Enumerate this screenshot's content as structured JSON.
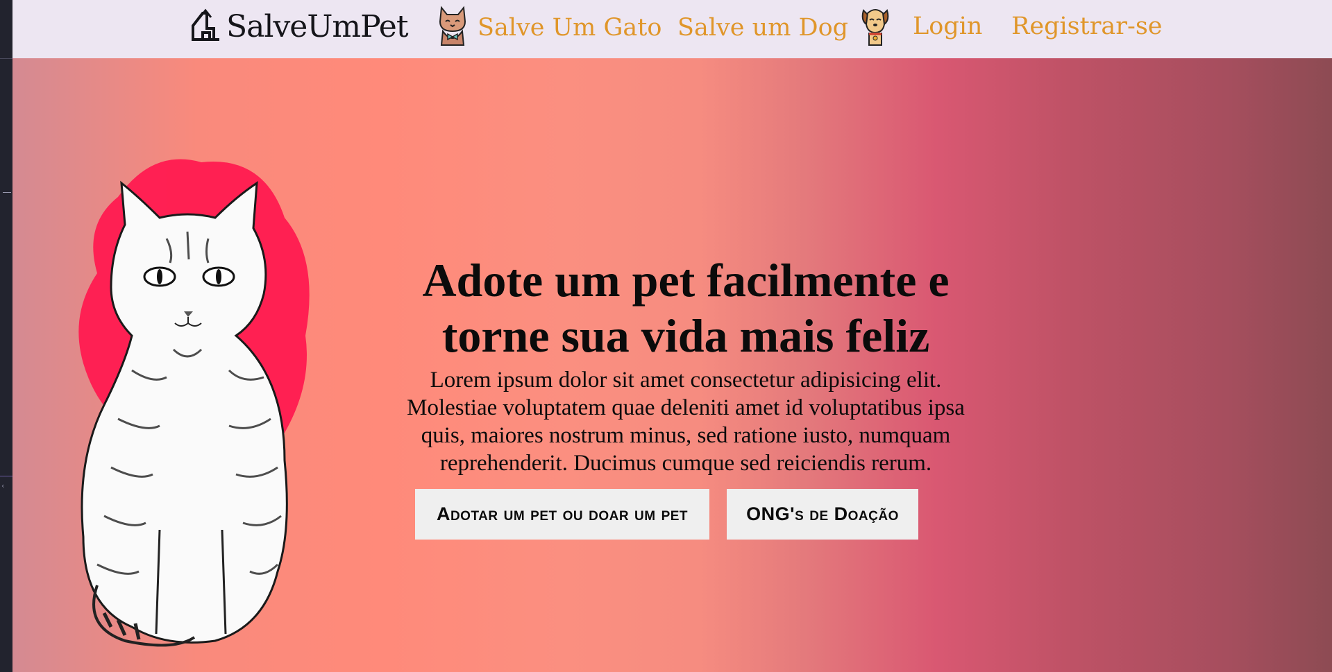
{
  "navbar": {
    "logo_text": "SalveUmPet",
    "items": [
      {
        "label": "Salve Um Gato",
        "icon": "cat-icon"
      },
      {
        "label": "Salve um Dog",
        "icon": "dog-icon"
      },
      {
        "label": "Login"
      },
      {
        "label": "Registrar-se"
      }
    ]
  },
  "hero": {
    "title_line1": "Adote um pet facilmente e",
    "title_line2": "torne sua vida mais feliz",
    "text": "Lorem ipsum dolor sit amet consectetur adipisicing elit. Molestiae voluptatem quae deleniti amet id voluptatibus ipsa quis, maiores nostrum minus, sed ratione iusto, numquam reprehenderit. Ducimus cumque sed reiciendis rerum.",
    "buttons": {
      "adopt": "Adotar um pet ou doar um pet",
      "ong": "ONG's de Doação"
    },
    "illustration": "cat-illustration"
  },
  "colors": {
    "navbar_bg": "#ede6f2",
    "nav_link": "#e0962a",
    "hero_gradient_start": "#f98a7c",
    "hero_gradient_end": "#8d4b53",
    "cat_blob": "#ff1a50",
    "button_bg": "#efefef"
  }
}
